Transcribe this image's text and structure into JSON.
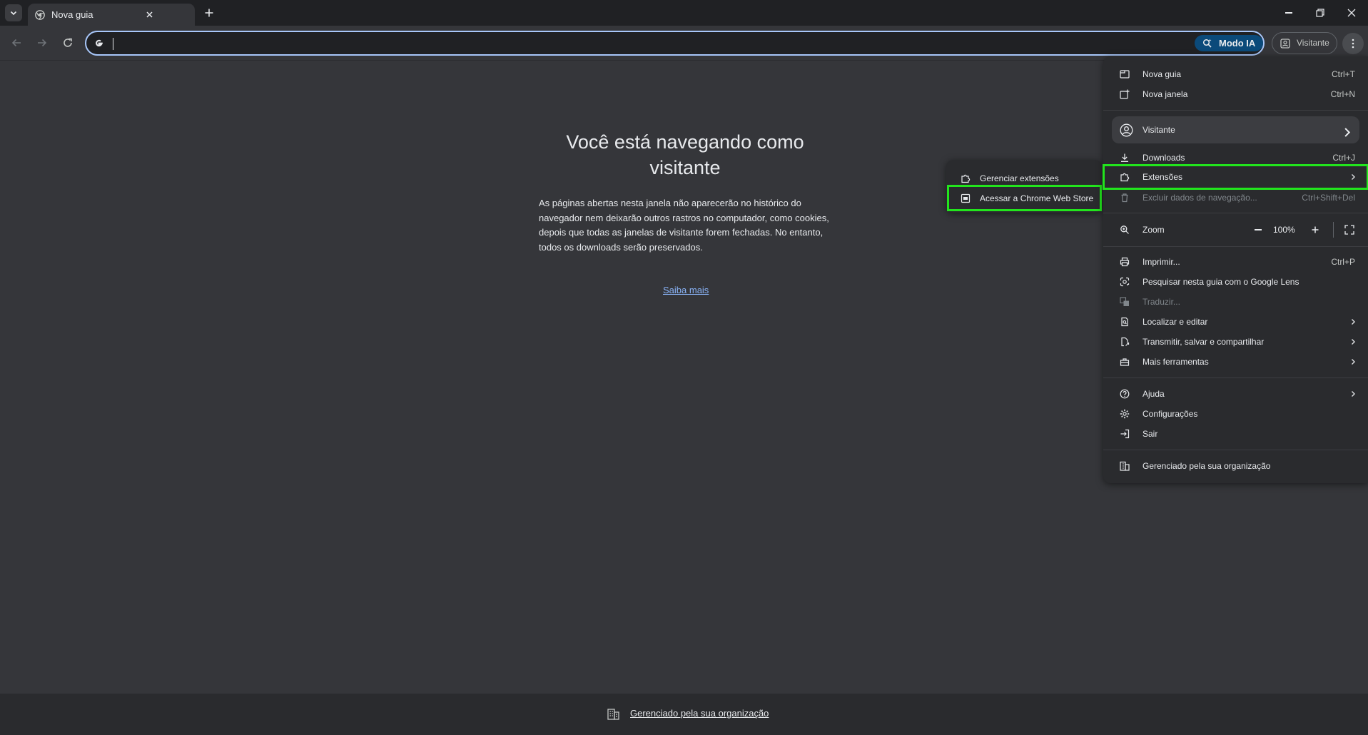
{
  "tab": {
    "title": "Nova guia"
  },
  "omnibox": {
    "value": "",
    "ai_mode_label": "Modo IA"
  },
  "profile": {
    "label": "Visitante"
  },
  "page": {
    "heading_line1": "Você está navegando como",
    "heading_line2": "visitante",
    "description": "As páginas abertas nesta janela não aparecerão no histórico do navegador nem deixarão outros rastros no computador, como cookies, depois que todas as janelas de visitante forem fechadas. No entanto, todos os downloads serão preservados.",
    "learn_more": "Saiba mais",
    "managed_notice": "Gerenciado pela sua organização"
  },
  "menu": {
    "new_tab": {
      "label": "Nova guia",
      "shortcut": "Ctrl+T"
    },
    "new_window": {
      "label": "Nova janela",
      "shortcut": "Ctrl+N"
    },
    "guest": {
      "label": "Visitante"
    },
    "downloads": {
      "label": "Downloads",
      "shortcut": "Ctrl+J"
    },
    "extensions": {
      "label": "Extensões"
    },
    "clear_data": {
      "label": "Excluir dados de navegação...",
      "shortcut": "Ctrl+Shift+Del"
    },
    "zoom": {
      "label": "Zoom",
      "value": "100%"
    },
    "print": {
      "label": "Imprimir...",
      "shortcut": "Ctrl+P"
    },
    "lens": {
      "label": "Pesquisar nesta guia com o Google Lens"
    },
    "translate": {
      "label": "Traduzir..."
    },
    "find_edit": {
      "label": "Localizar e editar"
    },
    "cast_save_share": {
      "label": "Transmitir, salvar e compartilhar"
    },
    "more_tools": {
      "label": "Mais ferramentas"
    },
    "help": {
      "label": "Ajuda"
    },
    "settings": {
      "label": "Configurações"
    },
    "exit": {
      "label": "Sair"
    },
    "managed": {
      "label": "Gerenciado pela sua organização"
    }
  },
  "extensions_submenu": {
    "manage": {
      "label": "Gerenciar extensões"
    },
    "web_store": {
      "label": "Acessar a Chrome Web Store"
    }
  },
  "icons": {
    "tab_favicon": "chrome-icon",
    "tab_search": "chevron-down-icon",
    "close_tab": "close-icon",
    "new_tab": "plus-icon",
    "back": "arrow-left-icon",
    "forward": "arrow-right-icon",
    "reload": "reload-icon",
    "google": "google-g-icon",
    "menu": "kebab-icon"
  },
  "colors": {
    "highlight": "#22e51d",
    "link": "#8ab4f8",
    "focus_ring": "#a8c7fa",
    "background": "#35363a"
  }
}
